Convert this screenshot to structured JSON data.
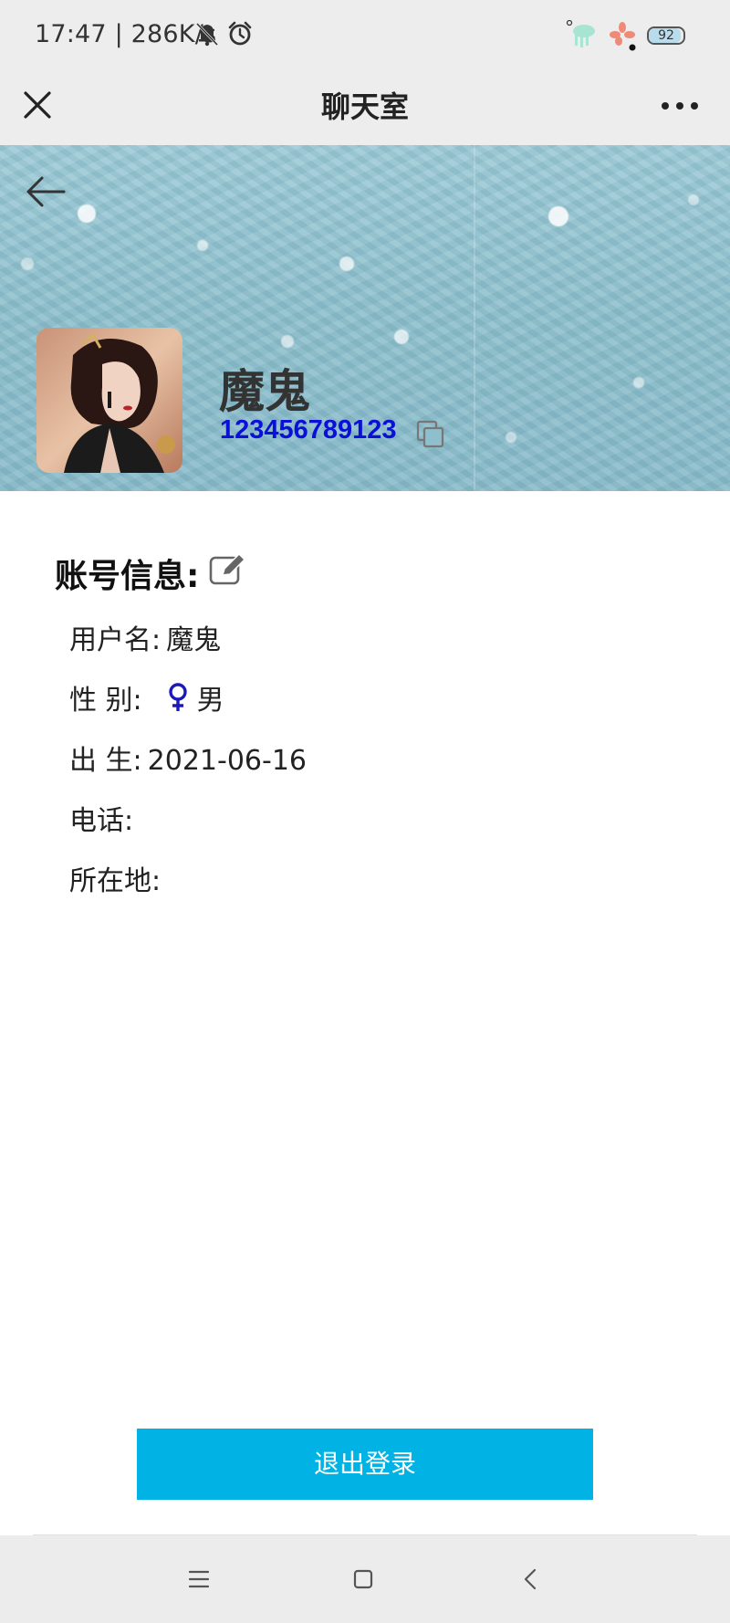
{
  "status_bar": {
    "time_speed": "17:47 | 286K/s",
    "battery_level": "92",
    "battery_fraction": 0.92
  },
  "title_bar": {
    "title": "聊天室"
  },
  "profile": {
    "nickname": "魔鬼",
    "user_id": "123456789123"
  },
  "account_info": {
    "section_title": "账号信息:",
    "username_label": "用户名:",
    "username_value": "魔鬼",
    "gender_label": "性 别:",
    "gender_value": "男",
    "birth_label": "出 生:",
    "birth_value": "2021-06-16",
    "phone_label": "电话:",
    "phone_value": "",
    "location_label": "所在地:",
    "location_value": ""
  },
  "actions": {
    "logout_label": "退出登录"
  },
  "colors": {
    "accent": "#00b3e4",
    "user_id": "#0a10d8",
    "gender_icon": "#1a1ab8"
  },
  "icons": {
    "close": "close-icon",
    "more": "more-icon",
    "back": "arrow-left-icon",
    "copy": "copy-icon",
    "edit": "edit-icon",
    "gender": "female-symbol-icon",
    "nav_menu": "menu-icon",
    "nav_home": "home-square-icon",
    "nav_back": "chevron-left-icon"
  }
}
